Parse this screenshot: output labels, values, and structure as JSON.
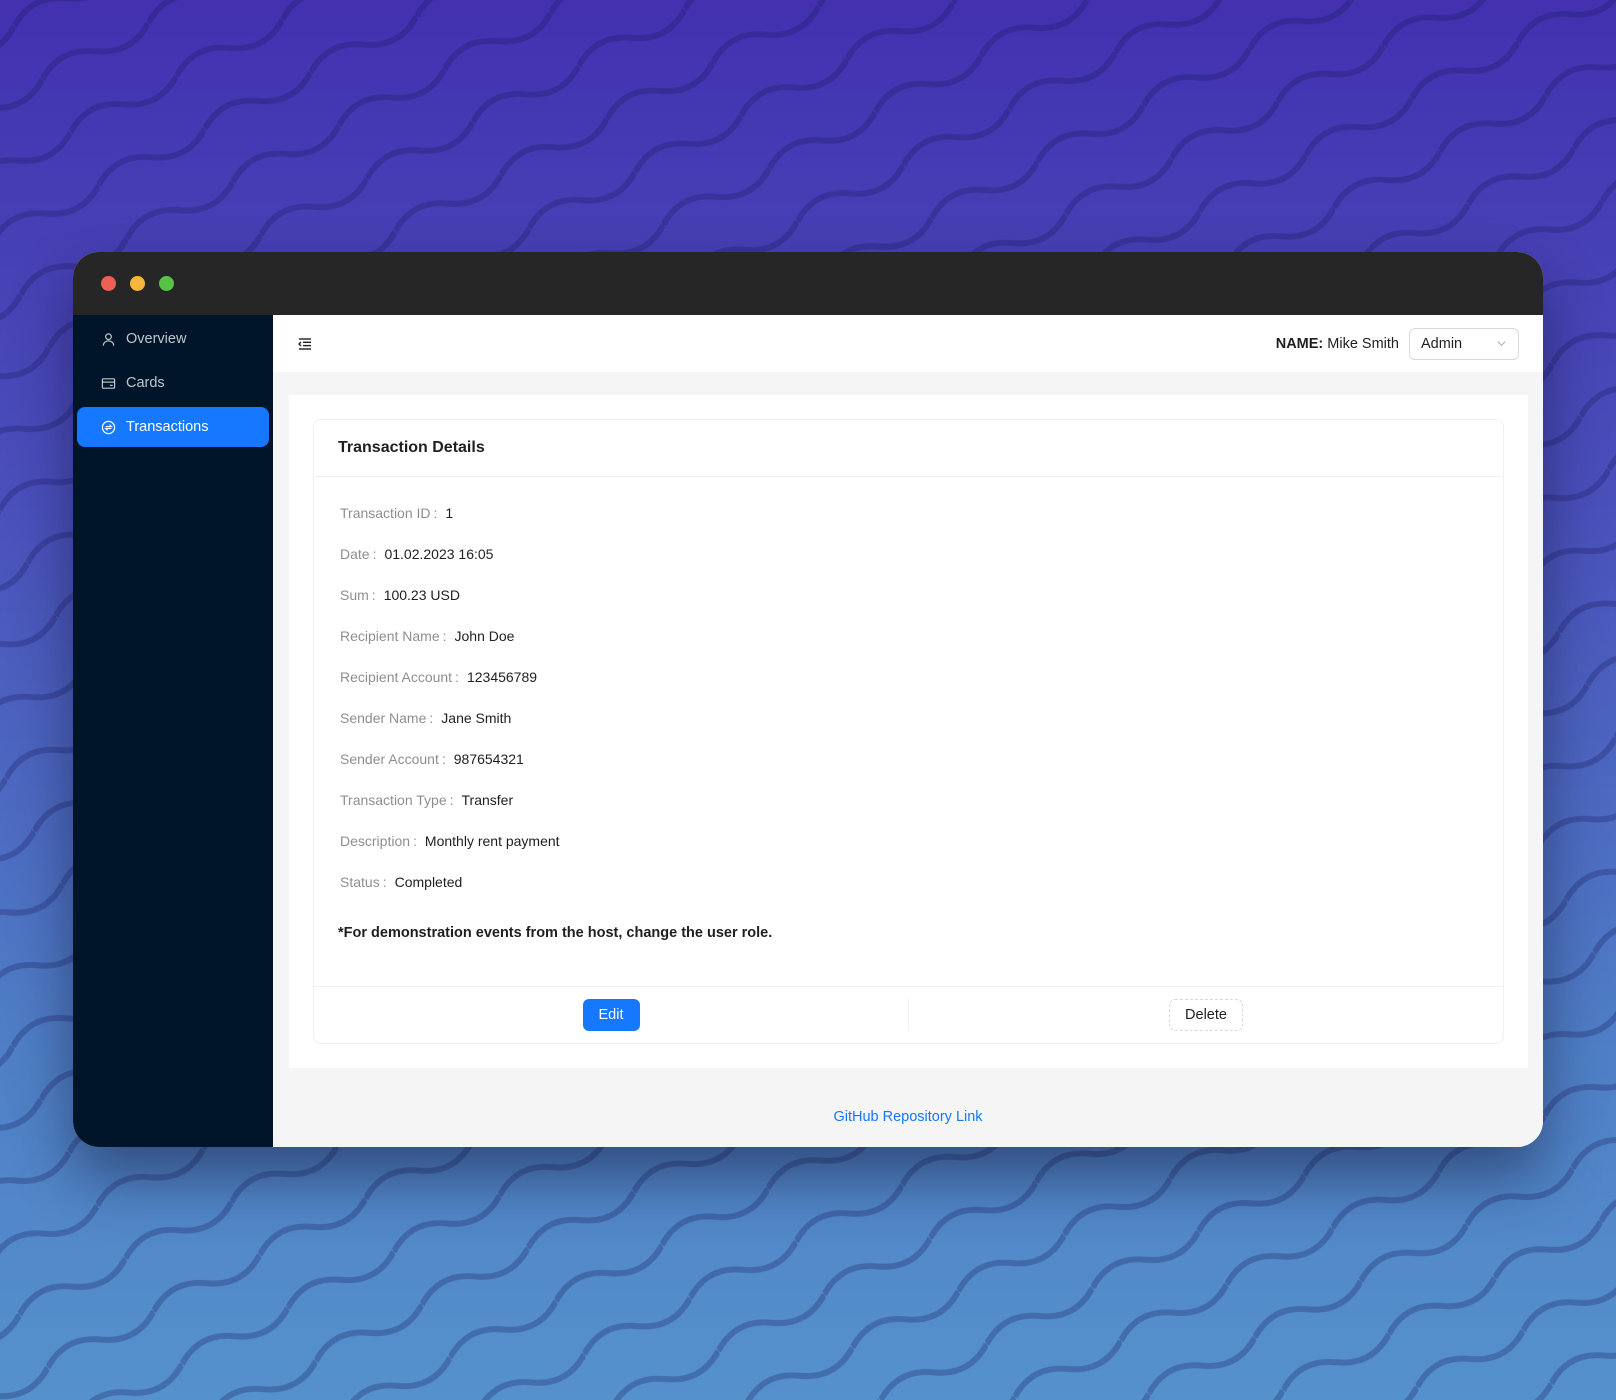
{
  "sidebar": {
    "items": [
      {
        "label": "Overview",
        "icon": "user-icon"
      },
      {
        "label": "Cards",
        "icon": "credit-card-icon"
      },
      {
        "label": "Transactions",
        "icon": "transaction-icon",
        "active": true
      }
    ]
  },
  "header": {
    "name_label": "NAME:",
    "name_value": "Mike Smith",
    "role_value": "Admin"
  },
  "card": {
    "title": "Transaction Details",
    "fields": [
      {
        "label": "Transaction ID",
        "value": "1"
      },
      {
        "label": "Date",
        "value": "01.02.2023 16:05"
      },
      {
        "label": "Sum",
        "value": "100.23 USD"
      },
      {
        "label": "Recipient Name",
        "value": "John Doe"
      },
      {
        "label": "Recipient Account",
        "value": "123456789"
      },
      {
        "label": "Sender Name",
        "value": "Jane Smith"
      },
      {
        "label": "Sender Account",
        "value": "987654321"
      },
      {
        "label": "Transaction Type",
        "value": "Transfer"
      },
      {
        "label": "Description",
        "value": "Monthly rent payment"
      },
      {
        "label": "Status",
        "value": "Completed"
      }
    ],
    "note": "*For demonstration events from the host, change the user role.",
    "edit_label": "Edit",
    "delete_label": "Delete"
  },
  "footer": {
    "link_label": "GitHub Repository Link"
  },
  "colors": {
    "accent": "#1677ff",
    "sidebar_bg": "#001529",
    "titlebar_bg": "#262626"
  }
}
